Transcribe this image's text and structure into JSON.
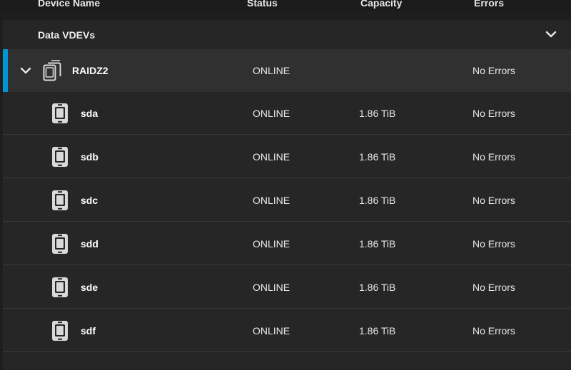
{
  "columns": {
    "name": "Device Name",
    "status": "Status",
    "capacity": "Capacity",
    "errors": "Errors"
  },
  "group": {
    "title": "Data VDEVs"
  },
  "vdev": {
    "name": "RAIDZ2",
    "status": "ONLINE",
    "capacity": "",
    "errors": "No Errors"
  },
  "disks": [
    {
      "name": "sda",
      "status": "ONLINE",
      "capacity": "1.86 TiB",
      "errors": "No Errors"
    },
    {
      "name": "sdb",
      "status": "ONLINE",
      "capacity": "1.86 TiB",
      "errors": "No Errors"
    },
    {
      "name": "sdc",
      "status": "ONLINE",
      "capacity": "1.86 TiB",
      "errors": "No Errors"
    },
    {
      "name": "sdd",
      "status": "ONLINE",
      "capacity": "1.86 TiB",
      "errors": "No Errors"
    },
    {
      "name": "sde",
      "status": "ONLINE",
      "capacity": "1.86 TiB",
      "errors": "No Errors"
    },
    {
      "name": "sdf",
      "status": "ONLINE",
      "capacity": "1.86 TiB",
      "errors": "No Errors"
    }
  ],
  "icons": {
    "group_toggle": "chevron-down-icon",
    "vdev_toggle": "chevron-down-icon",
    "vdev": "mirror-disks-icon",
    "disk": "hard-disk-icon"
  },
  "colors": {
    "accent": "#0095d5",
    "background": "#1e1e1e",
    "panel": "#262626",
    "selected_row": "#303030"
  }
}
